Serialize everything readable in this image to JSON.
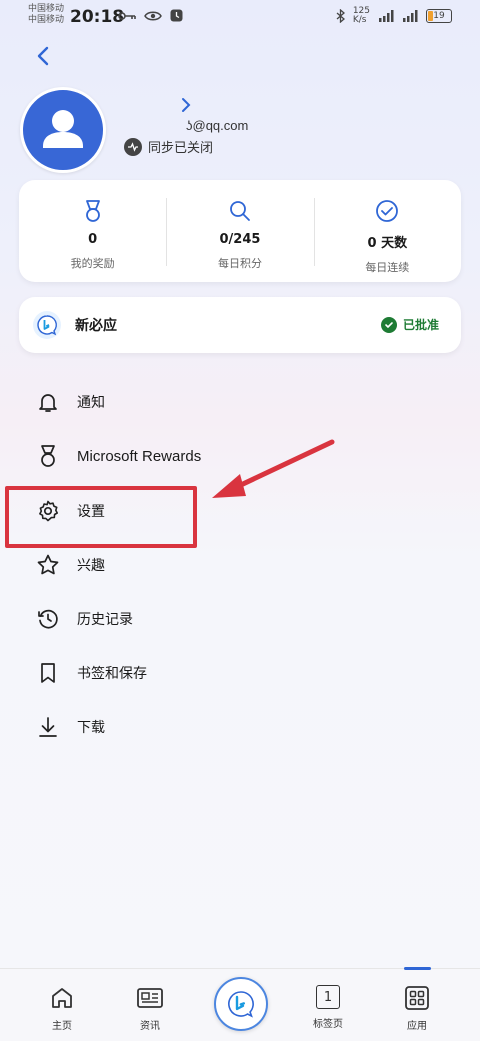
{
  "status_bar": {
    "carrier_1": "中国移动",
    "carrier_2": "中国移动",
    "time": "20:18",
    "net_speed_top": "125",
    "net_speed_bottom": "K/s",
    "battery_level": "19"
  },
  "header": {
    "back_icon": "back-chevron-icon"
  },
  "profile": {
    "email": "ʖ@qq.com",
    "sync_status": "同步已关闭"
  },
  "stats": [
    {
      "icon": "medal-icon",
      "value": "0",
      "label": "我的奖励"
    },
    {
      "icon": "search-icon",
      "value": "0/245",
      "label": "每日积分"
    },
    {
      "icon": "check-circle-icon",
      "value": "0 天数",
      "label": "每日连续"
    }
  ],
  "app_card": {
    "name": "新必应",
    "status": "已批准"
  },
  "menu": [
    {
      "name": "notifications",
      "icon": "bell-icon",
      "label": "通知"
    },
    {
      "name": "rewards",
      "icon": "medal-icon",
      "label": "Microsoft Rewards"
    },
    {
      "name": "settings",
      "icon": "gear-icon",
      "label": "设置"
    },
    {
      "name": "interests",
      "icon": "star-icon",
      "label": "兴趣"
    },
    {
      "name": "history",
      "icon": "history-icon",
      "label": "历史记录"
    },
    {
      "name": "bookmarks",
      "icon": "bookmark-icon",
      "label": "书签和保存"
    },
    {
      "name": "downloads",
      "icon": "download-icon",
      "label": "下载"
    }
  ],
  "bottom_nav": [
    {
      "name": "home",
      "icon": "home-icon",
      "label": "主页"
    },
    {
      "name": "news",
      "icon": "news-icon",
      "label": "资讯"
    },
    {
      "name": "bing",
      "icon": "bing-logo-icon",
      "label": ""
    },
    {
      "name": "tabs",
      "icon": "tab-count-icon",
      "label": "标签页",
      "count": "1"
    },
    {
      "name": "apps",
      "icon": "apps-grid-icon",
      "label": "应用"
    }
  ],
  "colors": {
    "accent": "#2f66d5",
    "highlight": "#d9343f",
    "approved": "#1e7b34"
  }
}
